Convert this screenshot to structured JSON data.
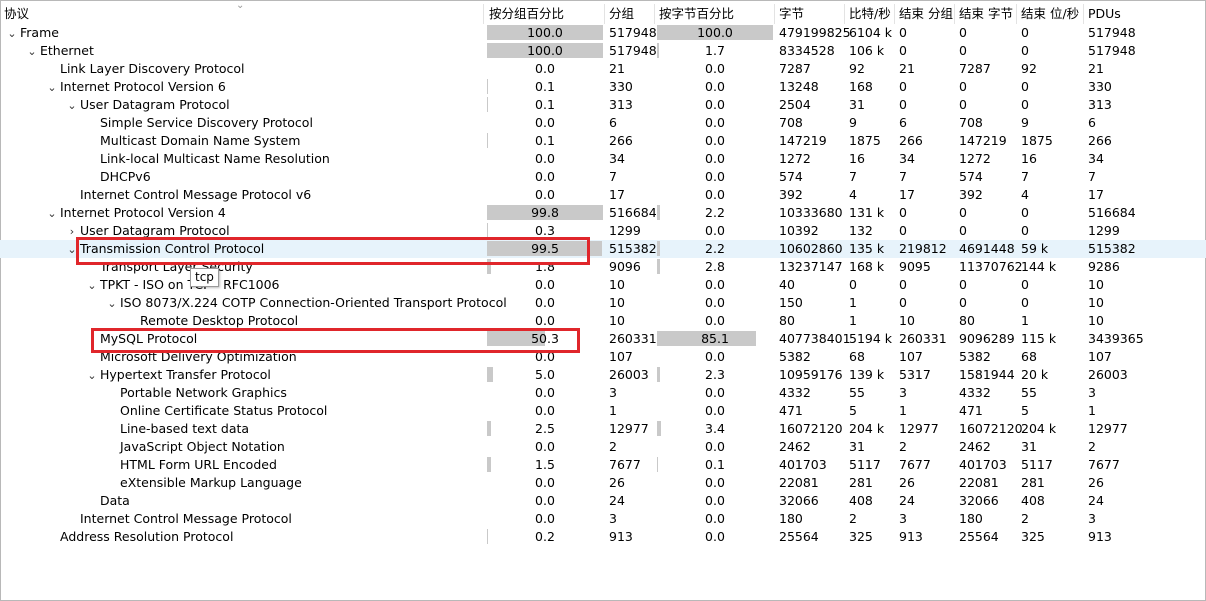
{
  "columns": [
    "协议",
    "按分组百分比",
    "分组",
    "按字节百分比",
    "字节",
    "比特/秒",
    "结束 分组",
    "结束 字节",
    "结束 位/秒",
    "PDUs"
  ],
  "tooltip": "tcp",
  "rows": [
    {
      "indent": 0,
      "toggle": "open",
      "name": "Frame",
      "pkt_pct": "100.0",
      "pkt_pct_v": 100,
      "packets": "517948",
      "byte_pct": "100.0",
      "byte_pct_v": 100,
      "bytes": "479199825",
      "bps": "6104 k",
      "end_pkts": "0",
      "end_bytes": "0",
      "end_bps": "0",
      "pdus": "517948"
    },
    {
      "indent": 1,
      "toggle": "open",
      "name": "Ethernet",
      "pkt_pct": "100.0",
      "pkt_pct_v": 100,
      "packets": "517948",
      "byte_pct": "1.7",
      "byte_pct_v": 1.7,
      "bytes": "8334528",
      "bps": "106 k",
      "end_pkts": "0",
      "end_bytes": "0",
      "end_bps": "0",
      "pdus": "517948"
    },
    {
      "indent": 2,
      "toggle": "",
      "name": "Link Layer Discovery Protocol",
      "pkt_pct": "0.0",
      "pkt_pct_v": 0,
      "packets": "21",
      "byte_pct": "0.0",
      "byte_pct_v": 0,
      "bytes": "7287",
      "bps": "92",
      "end_pkts": "21",
      "end_bytes": "7287",
      "end_bps": "92",
      "pdus": "21"
    },
    {
      "indent": 2,
      "toggle": "open",
      "name": "Internet Protocol Version 6",
      "pkt_pct": "0.1",
      "pkt_pct_v": 0.1,
      "packets": "330",
      "byte_pct": "0.0",
      "byte_pct_v": 0,
      "bytes": "13248",
      "bps": "168",
      "end_pkts": "0",
      "end_bytes": "0",
      "end_bps": "0",
      "pdus": "330"
    },
    {
      "indent": 3,
      "toggle": "open",
      "name": "User Datagram Protocol",
      "pkt_pct": "0.1",
      "pkt_pct_v": 0.1,
      "packets": "313",
      "byte_pct": "0.0",
      "byte_pct_v": 0,
      "bytes": "2504",
      "bps": "31",
      "end_pkts": "0",
      "end_bytes": "0",
      "end_bps": "0",
      "pdus": "313"
    },
    {
      "indent": 4,
      "toggle": "",
      "name": "Simple Service Discovery Protocol",
      "pkt_pct": "0.0",
      "pkt_pct_v": 0,
      "packets": "6",
      "byte_pct": "0.0",
      "byte_pct_v": 0,
      "bytes": "708",
      "bps": "9",
      "end_pkts": "6",
      "end_bytes": "708",
      "end_bps": "9",
      "pdus": "6"
    },
    {
      "indent": 4,
      "toggle": "",
      "name": "Multicast Domain Name System",
      "pkt_pct": "0.1",
      "pkt_pct_v": 0.1,
      "packets": "266",
      "byte_pct": "0.0",
      "byte_pct_v": 0,
      "bytes": "147219",
      "bps": "1875",
      "end_pkts": "266",
      "end_bytes": "147219",
      "end_bps": "1875",
      "pdus": "266"
    },
    {
      "indent": 4,
      "toggle": "",
      "name": "Link-local Multicast Name Resolution",
      "pkt_pct": "0.0",
      "pkt_pct_v": 0,
      "packets": "34",
      "byte_pct": "0.0",
      "byte_pct_v": 0,
      "bytes": "1272",
      "bps": "16",
      "end_pkts": "34",
      "end_bytes": "1272",
      "end_bps": "16",
      "pdus": "34"
    },
    {
      "indent": 4,
      "toggle": "",
      "name": "DHCPv6",
      "pkt_pct": "0.0",
      "pkt_pct_v": 0,
      "packets": "7",
      "byte_pct": "0.0",
      "byte_pct_v": 0,
      "bytes": "574",
      "bps": "7",
      "end_pkts": "7",
      "end_bytes": "574",
      "end_bps": "7",
      "pdus": "7"
    },
    {
      "indent": 3,
      "toggle": "",
      "name": "Internet Control Message Protocol v6",
      "pkt_pct": "0.0",
      "pkt_pct_v": 0,
      "packets": "17",
      "byte_pct": "0.0",
      "byte_pct_v": 0,
      "bytes": "392",
      "bps": "4",
      "end_pkts": "17",
      "end_bytes": "392",
      "end_bps": "4",
      "pdus": "17"
    },
    {
      "indent": 2,
      "toggle": "open",
      "name": "Internet Protocol Version 4",
      "pkt_pct": "99.8",
      "pkt_pct_v": 99.8,
      "packets": "516684",
      "byte_pct": "2.2",
      "byte_pct_v": 2.2,
      "bytes": "10333680",
      "bps": "131 k",
      "end_pkts": "0",
      "end_bytes": "0",
      "end_bps": "0",
      "pdus": "516684"
    },
    {
      "indent": 3,
      "toggle": "closed",
      "name": "User Datagram Protocol",
      "pkt_pct": "0.3",
      "pkt_pct_v": 0.3,
      "packets": "1299",
      "byte_pct": "0.0",
      "byte_pct_v": 0,
      "bytes": "10392",
      "bps": "132",
      "end_pkts": "0",
      "end_bytes": "0",
      "end_bps": "0",
      "pdus": "1299"
    },
    {
      "indent": 3,
      "toggle": "open",
      "name": "Transmission Control Protocol",
      "pkt_pct": "99.5",
      "pkt_pct_v": 99.5,
      "packets": "515382",
      "byte_pct": "2.2",
      "byte_pct_v": 2.2,
      "bytes": "10602860",
      "bps": "135 k",
      "end_pkts": "219812",
      "end_bytes": "4691448",
      "end_bps": "59 k",
      "pdus": "515382",
      "selected": true
    },
    {
      "indent": 4,
      "toggle": "",
      "name": "Transport Layer Security",
      "pkt_pct": "1.8",
      "pkt_pct_v": 1.8,
      "packets": "9096",
      "byte_pct": "2.8",
      "byte_pct_v": 2.8,
      "bytes": "13237147",
      "bps": "168 k",
      "end_pkts": "9095",
      "end_bytes": "11370762",
      "end_bps": "144 k",
      "pdus": "9286"
    },
    {
      "indent": 4,
      "toggle": "open",
      "name": "TPKT - ISO on TCP - RFC1006",
      "pkt_pct": "0.0",
      "pkt_pct_v": 0,
      "packets": "10",
      "byte_pct": "0.0",
      "byte_pct_v": 0,
      "bytes": "40",
      "bps": "0",
      "end_pkts": "0",
      "end_bytes": "0",
      "end_bps": "0",
      "pdus": "10"
    },
    {
      "indent": 5,
      "toggle": "open",
      "name": "ISO 8073/X.224 COTP Connection-Oriented Transport Protocol",
      "pkt_pct": "0.0",
      "pkt_pct_v": 0,
      "packets": "10",
      "byte_pct": "0.0",
      "byte_pct_v": 0,
      "bytes": "150",
      "bps": "1",
      "end_pkts": "0",
      "end_bytes": "0",
      "end_bps": "0",
      "pdus": "10"
    },
    {
      "indent": 6,
      "toggle": "",
      "name": "Remote Desktop Protocol",
      "pkt_pct": "0.0",
      "pkt_pct_v": 0,
      "packets": "10",
      "byte_pct": "0.0",
      "byte_pct_v": 0,
      "bytes": "80",
      "bps": "1",
      "end_pkts": "10",
      "end_bytes": "80",
      "end_bps": "1",
      "pdus": "10"
    },
    {
      "indent": 4,
      "toggle": "",
      "name": "MySQL Protocol",
      "pkt_pct": "50.3",
      "pkt_pct_v": 50.3,
      "packets": "260331",
      "byte_pct": "85.1",
      "byte_pct_v": 85.1,
      "bytes": "407738401",
      "bps": "5194 k",
      "end_pkts": "260331",
      "end_bytes": "9096289",
      "end_bps": "115 k",
      "pdus": "3439365"
    },
    {
      "indent": 4,
      "toggle": "",
      "name": "Microsoft Delivery Optimization",
      "pkt_pct": "0.0",
      "pkt_pct_v": 0,
      "packets": "107",
      "byte_pct": "0.0",
      "byte_pct_v": 0,
      "bytes": "5382",
      "bps": "68",
      "end_pkts": "107",
      "end_bytes": "5382",
      "end_bps": "68",
      "pdus": "107"
    },
    {
      "indent": 4,
      "toggle": "open",
      "name": "Hypertext Transfer Protocol",
      "pkt_pct": "5.0",
      "pkt_pct_v": 5.0,
      "packets": "26003",
      "byte_pct": "2.3",
      "byte_pct_v": 2.3,
      "bytes": "10959176",
      "bps": "139 k",
      "end_pkts": "5317",
      "end_bytes": "1581944",
      "end_bps": "20 k",
      "pdus": "26003"
    },
    {
      "indent": 5,
      "toggle": "",
      "name": "Portable Network Graphics",
      "pkt_pct": "0.0",
      "pkt_pct_v": 0,
      "packets": "3",
      "byte_pct": "0.0",
      "byte_pct_v": 0,
      "bytes": "4332",
      "bps": "55",
      "end_pkts": "3",
      "end_bytes": "4332",
      "end_bps": "55",
      "pdus": "3"
    },
    {
      "indent": 5,
      "toggle": "",
      "name": "Online Certificate Status Protocol",
      "pkt_pct": "0.0",
      "pkt_pct_v": 0,
      "packets": "1",
      "byte_pct": "0.0",
      "byte_pct_v": 0,
      "bytes": "471",
      "bps": "5",
      "end_pkts": "1",
      "end_bytes": "471",
      "end_bps": "5",
      "pdus": "1"
    },
    {
      "indent": 5,
      "toggle": "",
      "name": "Line-based text data",
      "pkt_pct": "2.5",
      "pkt_pct_v": 2.5,
      "packets": "12977",
      "byte_pct": "3.4",
      "byte_pct_v": 3.4,
      "bytes": "16072120",
      "bps": "204 k",
      "end_pkts": "12977",
      "end_bytes": "16072120",
      "end_bps": "204 k",
      "pdus": "12977"
    },
    {
      "indent": 5,
      "toggle": "",
      "name": "JavaScript Object Notation",
      "pkt_pct": "0.0",
      "pkt_pct_v": 0,
      "packets": "2",
      "byte_pct": "0.0",
      "byte_pct_v": 0,
      "bytes": "2462",
      "bps": "31",
      "end_pkts": "2",
      "end_bytes": "2462",
      "end_bps": "31",
      "pdus": "2"
    },
    {
      "indent": 5,
      "toggle": "",
      "name": "HTML Form URL Encoded",
      "pkt_pct": "1.5",
      "pkt_pct_v": 1.5,
      "packets": "7677",
      "byte_pct": "0.1",
      "byte_pct_v": 0.1,
      "bytes": "401703",
      "bps": "5117",
      "end_pkts": "7677",
      "end_bytes": "401703",
      "end_bps": "5117",
      "pdus": "7677"
    },
    {
      "indent": 5,
      "toggle": "",
      "name": "eXtensible Markup Language",
      "pkt_pct": "0.0",
      "pkt_pct_v": 0,
      "packets": "26",
      "byte_pct": "0.0",
      "byte_pct_v": 0,
      "bytes": "22081",
      "bps": "281",
      "end_pkts": "26",
      "end_bytes": "22081",
      "end_bps": "281",
      "pdus": "26"
    },
    {
      "indent": 4,
      "toggle": "",
      "name": "Data",
      "pkt_pct": "0.0",
      "pkt_pct_v": 0,
      "packets": "24",
      "byte_pct": "0.0",
      "byte_pct_v": 0,
      "bytes": "32066",
      "bps": "408",
      "end_pkts": "24",
      "end_bytes": "32066",
      "end_bps": "408",
      "pdus": "24"
    },
    {
      "indent": 3,
      "toggle": "",
      "name": "Internet Control Message Protocol",
      "pkt_pct": "0.0",
      "pkt_pct_v": 0,
      "packets": "3",
      "byte_pct": "0.0",
      "byte_pct_v": 0,
      "bytes": "180",
      "bps": "2",
      "end_pkts": "3",
      "end_bytes": "180",
      "end_bps": "2",
      "pdus": "3"
    },
    {
      "indent": 2,
      "toggle": "",
      "name": "Address Resolution Protocol",
      "pkt_pct": "0.2",
      "pkt_pct_v": 0.2,
      "packets": "913",
      "byte_pct": "0.0",
      "byte_pct_v": 0,
      "bytes": "25564",
      "bps": "325",
      "end_pkts": "913",
      "end_bytes": "25564",
      "end_bps": "325",
      "pdus": "913"
    }
  ]
}
